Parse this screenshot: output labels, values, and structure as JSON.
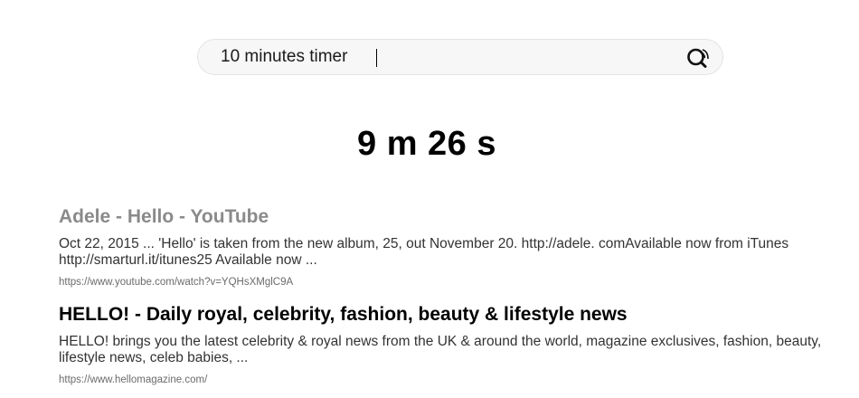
{
  "search": {
    "query": "10 minutes timer",
    "icon": "search-icon"
  },
  "timer": {
    "display": "9 m 26 s"
  },
  "results": [
    {
      "title": "Adele - Hello - YouTube",
      "snippet": "Oct 22, 2015 ... 'Hello' is taken from the new album, 25, out November 20. http://adele. comAvailable now from iTunes http://smarturl.it/itunes25 Available now ...",
      "url": "https://www.youtube.com/watch?v=YQHsXMglC9A",
      "visited": true
    },
    {
      "title": "HELLO! - Daily royal, celebrity, fashion, beauty & lifestyle news",
      "snippet": "HELLO! brings you the latest celebrity & royal news from the UK & around the world, magazine exclusives, fashion, beauty, lifestyle news, celeb babies, ...",
      "url": "https://www.hellomagazine.com/",
      "visited": false
    }
  ],
  "colors": {
    "visited_title": "#8a8a8a",
    "title": "#000000",
    "snippet": "#333333",
    "url": "#6b6b6b",
    "search_bg": "#f7f7f7"
  }
}
